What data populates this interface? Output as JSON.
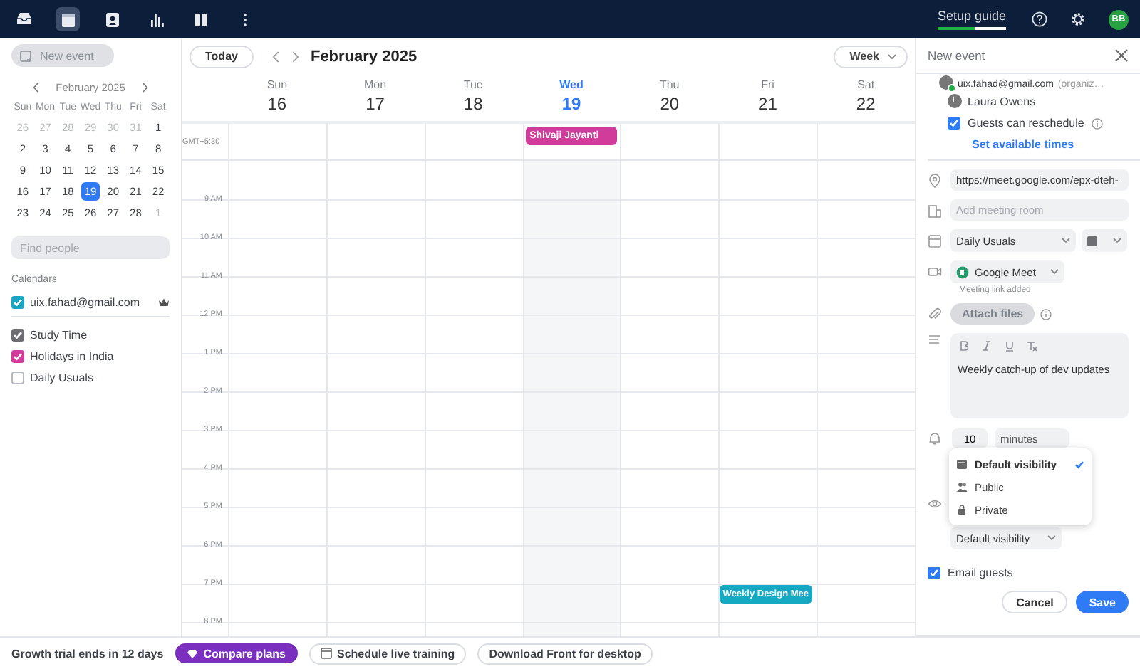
{
  "nav": {
    "icons": [
      {
        "kind": "inbox",
        "selected": false
      },
      {
        "kind": "calendar",
        "selected": true
      },
      {
        "kind": "contacts",
        "selected": false
      },
      {
        "kind": "analytics",
        "selected": false
      },
      {
        "kind": "split",
        "selected": false
      },
      {
        "kind": "more",
        "selected": false
      }
    ],
    "setup_guide": {
      "label": "Setup guide",
      "level": 0.55
    },
    "avatar": {
      "initials": "BB"
    }
  },
  "sidebar": {
    "new_event": "New event",
    "mini_calendar": {
      "month": "February 2025",
      "weekdays": [
        "Sun",
        "Mon",
        "Tue",
        "Wed",
        "Thu",
        "Fri",
        "Sat"
      ],
      "days": [
        {
          "label": "26",
          "muted": true,
          "selected": false
        },
        {
          "label": "27",
          "muted": true,
          "selected": false
        },
        {
          "label": "28",
          "muted": true,
          "selected": false
        },
        {
          "label": "29",
          "muted": true,
          "selected": false
        },
        {
          "label": "30",
          "muted": true,
          "selected": false
        },
        {
          "label": "31",
          "muted": true,
          "selected": false
        },
        {
          "label": "1",
          "muted": false,
          "selected": false
        },
        {
          "label": "2",
          "muted": false,
          "selected": false
        },
        {
          "label": "3",
          "muted": false,
          "selected": false
        },
        {
          "label": "4",
          "muted": false,
          "selected": false
        },
        {
          "label": "5",
          "muted": false,
          "selected": false
        },
        {
          "label": "6",
          "muted": false,
          "selected": false
        },
        {
          "label": "7",
          "muted": false,
          "selected": false
        },
        {
          "label": "8",
          "muted": false,
          "selected": false
        },
        {
          "label": "9",
          "muted": false,
          "selected": false
        },
        {
          "label": "10",
          "muted": false,
          "selected": false
        },
        {
          "label": "11",
          "muted": false,
          "selected": false
        },
        {
          "label": "12",
          "muted": false,
          "selected": false
        },
        {
          "label": "13",
          "muted": false,
          "selected": false
        },
        {
          "label": "14",
          "muted": false,
          "selected": false
        },
        {
          "label": "15",
          "muted": false,
          "selected": false
        },
        {
          "label": "16",
          "muted": false,
          "selected": false
        },
        {
          "label": "17",
          "muted": false,
          "selected": false
        },
        {
          "label": "18",
          "muted": false,
          "selected": false
        },
        {
          "label": "19",
          "muted": false,
          "selected": true
        },
        {
          "label": "20",
          "muted": false,
          "selected": false
        },
        {
          "label": "21",
          "muted": false,
          "selected": false
        },
        {
          "label": "22",
          "muted": false,
          "selected": false
        },
        {
          "label": "23",
          "muted": false,
          "selected": false
        },
        {
          "label": "24",
          "muted": false,
          "selected": false
        },
        {
          "label": "25",
          "muted": false,
          "selected": false
        },
        {
          "label": "26",
          "muted": false,
          "selected": false
        },
        {
          "label": "27",
          "muted": false,
          "selected": false
        },
        {
          "label": "28",
          "muted": false,
          "selected": false
        },
        {
          "label": "1",
          "muted": true,
          "selected": false
        }
      ]
    },
    "find_people": {
      "placeholder": "Find people"
    },
    "calendars": {
      "heading": "Calendars",
      "items": [
        {
          "label": "uix.fahad@gmail.com",
          "checked": true,
          "color": "#1ba6c4",
          "owner": true
        },
        {
          "label": "Study Time",
          "checked": true,
          "color": "#6e6e73",
          "owner": false
        },
        {
          "label": "Holidays in India",
          "checked": true,
          "color": "#d13c9a",
          "owner": false
        },
        {
          "label": "Daily Usuals",
          "checked": false,
          "owner": false
        }
      ]
    }
  },
  "calendar": {
    "today": "Today",
    "title": "February 2025",
    "view": "Week",
    "timezone": "GMT+5:30",
    "days": [
      {
        "name": "Sun",
        "number": "16",
        "selected": false
      },
      {
        "name": "Mon",
        "number": "17",
        "selected": false
      },
      {
        "name": "Tue",
        "number": "18",
        "selected": false
      },
      {
        "name": "Wed",
        "number": "19",
        "selected": true,
        "events": [
          {
            "title": "Shivaji Jayanti",
            "color": "#d13c9a",
            "kind": "all_day"
          }
        ]
      },
      {
        "name": "Thu",
        "number": "20",
        "selected": false
      },
      {
        "name": "Fri",
        "number": "21",
        "selected": false
      },
      {
        "name": "Sat",
        "number": "22",
        "selected": false
      }
    ],
    "hours": [
      {
        "label": "9 AM"
      },
      {
        "label": "10 AM"
      },
      {
        "label": "11 AM"
      },
      {
        "label": "12 PM"
      },
      {
        "label": "1 PM"
      },
      {
        "label": "2 PM"
      },
      {
        "label": "3 PM"
      },
      {
        "label": "4 PM"
      },
      {
        "label": "5 PM"
      },
      {
        "label": "6 PM"
      },
      {
        "label": "7 PM",
        "cells": [
          null,
          null,
          null,
          null,
          null,
          {
            "title": "Weekly Design Mee",
            "color": "#16a9c2",
            "kind": "timed"
          },
          null
        ]
      },
      {
        "label": "8 PM"
      }
    ]
  },
  "panel": {
    "title": "New event",
    "attendees": [
      {
        "name": "uix.fahad@gmail.com",
        "note": "(organiz…",
        "kind": "organizer"
      },
      {
        "name": "Laura Owens",
        "initial": "L",
        "kind": "guest"
      }
    ],
    "guests_can_reschedule": {
      "label": "Guests can reschedule",
      "checked": true
    },
    "set_available_times": "Set available times",
    "location": {
      "value": "https://meet.google.com/epx-dteh-"
    },
    "meeting_room": {
      "placeholder": "Add meeting room"
    },
    "calendar_select": "Daily Usuals",
    "color_select": {
      "color": "#6e6e73"
    },
    "conferencing": "Google Meet",
    "conferencing_note": "Meeting link added",
    "attach": "Attach files",
    "description": "Weekly catch-up of dev updates",
    "reminder": {
      "value": "10",
      "unit": "minutes"
    },
    "visibility_menu": [
      {
        "label": "Default visibility",
        "kind": "default",
        "selected": true
      },
      {
        "label": "Public",
        "kind": "public",
        "selected": false
      },
      {
        "label": "Private",
        "kind": "private",
        "selected": false
      }
    ],
    "visibility_select": "Default visibility",
    "email_guests": {
      "label": "Email guests",
      "checked": true
    },
    "cancel": "Cancel",
    "save": "Save"
  },
  "bottom_bar": {
    "trial": "Growth trial ends in 12 days",
    "compare": "Compare plans",
    "training": "Schedule live training",
    "download": "Download Front for desktop"
  }
}
